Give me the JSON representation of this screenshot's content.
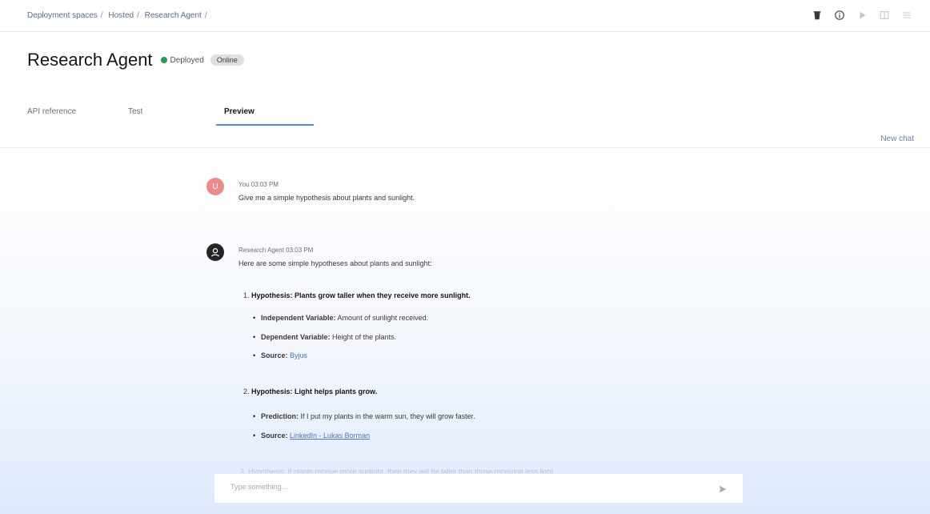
{
  "breadcrumb": [
    "Deployment spaces",
    "Hosted",
    "Research Agent"
  ],
  "header": {
    "title": "Research Agent",
    "status": "Deployed",
    "tag": "Online"
  },
  "tabs": [
    "API reference",
    "Test",
    "Preview"
  ],
  "active_tab": "Preview",
  "new_chat_label": "New chat",
  "messages": {
    "user": {
      "initial": "U",
      "meta": "You 03:03 PM",
      "text": "Give me a simple hypothesis about plants and sunlight."
    },
    "agent": {
      "meta": "Research Agent 03:03 PM",
      "intro": "Here are some simple hypotheses about plants and sunlight:",
      "h1": {
        "num": "1.",
        "title": "Hypothesis: Plants grow taller when they receive more sunlight.",
        "iv_label": "Independent Variable:",
        "iv_value": "Amount of sunlight received.",
        "dv_label": "Dependent Variable:",
        "dv_value": "Height of the plants.",
        "src_label": "Source:",
        "src_value": "Byjus"
      },
      "h2": {
        "num": "2.",
        "title": "Hypothesis: Light helps plants grow.",
        "pred_label": "Prediction:",
        "pred_value": "If I put my plants in the warm sun, they will grow faster.",
        "src_label": "Source:",
        "src_value": "LinkedIn - Lukas Borman"
      },
      "h3_faded": "3. Hypothesis: If plants receive more sunlight, then they will be taller than those receiving less light."
    }
  },
  "input": {
    "placeholder": "Type something..."
  },
  "colors": {
    "accent": "#4589ff",
    "status_green": "#24a148",
    "user_avatar": "#f08a8a"
  }
}
